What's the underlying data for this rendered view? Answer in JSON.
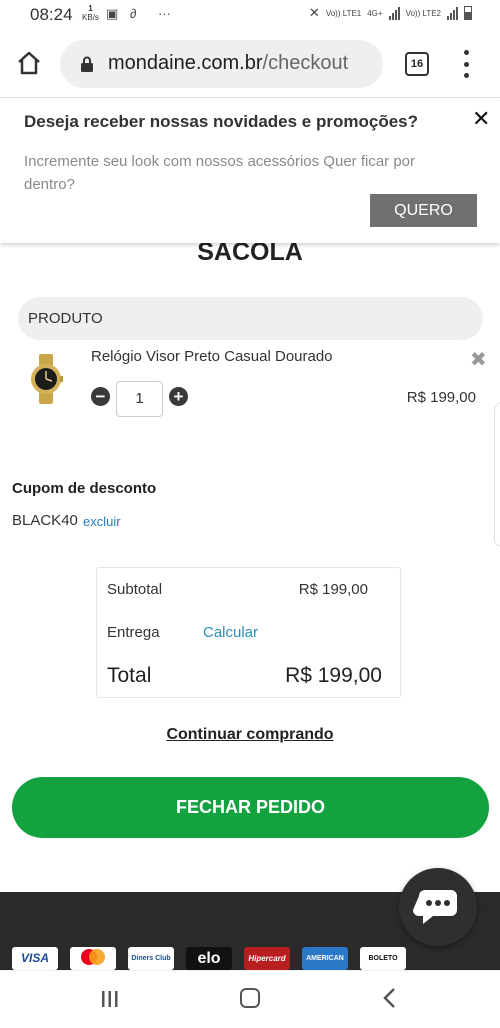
{
  "status_bar": {
    "time": "08:24",
    "speed_value": "1",
    "speed_unit": "KB/s",
    "sim1_label": "Vo)) LTE1",
    "net_label": "4G+",
    "sim2_label": "Vo)) LTE2"
  },
  "browser": {
    "url_host": "mondaine.com.br",
    "url_path": "/checkout",
    "tab_count": "16"
  },
  "banner": {
    "title": "Deseja receber nossas novidades e promoções?",
    "close_label": "✕",
    "text": "Incremente seu look com nossos acessórios Quer ficar por dentro?",
    "button_label": "QUERO"
  },
  "cart": {
    "title": "SACOLA",
    "column_header": "PRODUTO",
    "items": [
      {
        "name": "Relógio Visor Preto Casual Dourado",
        "quantity": "1",
        "price": "R$ 199,00"
      }
    ]
  },
  "coupon": {
    "title": "Cupom de desconto",
    "code": "BLACK40",
    "remove_label": "excluir"
  },
  "summary": {
    "subtotal_label": "Subtotal",
    "subtotal_value": "R$ 199,00",
    "shipping_label": "Entrega",
    "shipping_action": "Calcular",
    "total_label": "Total",
    "total_value": "R$ 199,00"
  },
  "actions": {
    "continue_label": "Continuar comprando",
    "checkout_label": "FECHAR PEDIDO"
  },
  "payment_methods": [
    {
      "name": "VISA"
    },
    {
      "name": "mastercard-logo"
    },
    {
      "name": "Diners Club"
    },
    {
      "name": "elo"
    },
    {
      "name": "Hipercard"
    },
    {
      "name": "AMERICAN EXPRESS"
    },
    {
      "name": "BOLETO"
    }
  ],
  "colors": {
    "checkout_green": "#13a23f",
    "link_blue": "#2b8fbb",
    "banner_button_gray": "#707070",
    "footer_dark": "#2a2a2a"
  }
}
